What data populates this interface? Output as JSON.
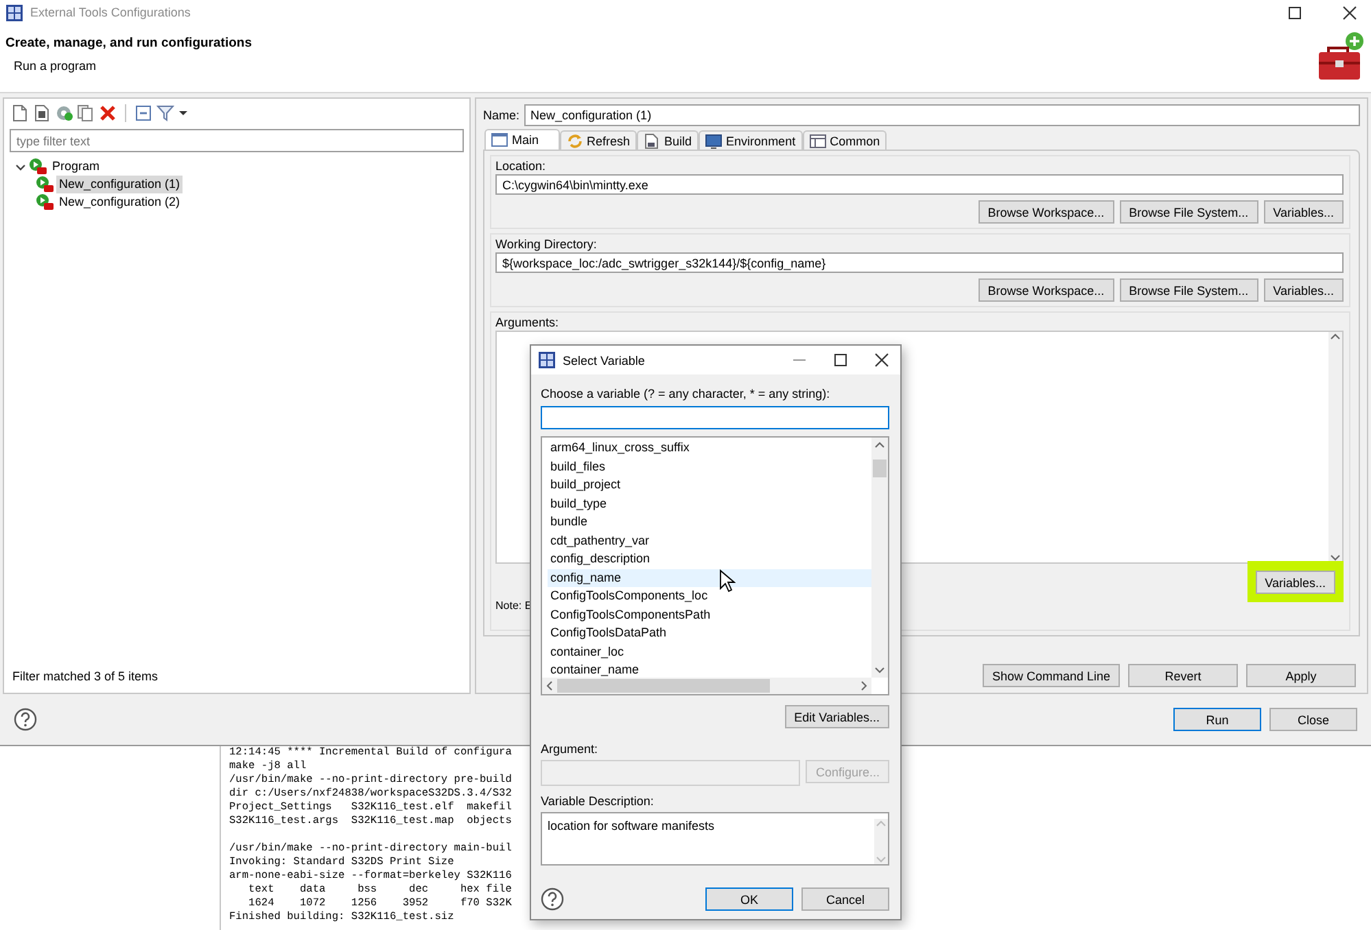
{
  "window": {
    "title": "External Tools Configurations"
  },
  "header": {
    "title": "Create, manage, and run configurations",
    "subtitle": "Run a program"
  },
  "filter": {
    "placeholder": "type filter text"
  },
  "tree": [
    {
      "label": "Program",
      "expanded": true,
      "selected": false,
      "children": [
        {
          "label": "New_configuration (1)",
          "selected": true
        },
        {
          "label": "New_configuration (2)",
          "selected": false
        }
      ]
    }
  ],
  "filter_status": "Filter matched 3 of 5 items",
  "name": {
    "label": "Name:",
    "value": "New_configuration (1)"
  },
  "tabs": [
    {
      "label": "Main",
      "kind": "window",
      "selected": true
    },
    {
      "label": "Refresh",
      "kind": "refresh",
      "selected": false
    },
    {
      "label": "Build",
      "kind": "document",
      "selected": false
    },
    {
      "label": "Environment",
      "kind": "monitor",
      "selected": false
    },
    {
      "label": "Common",
      "kind": "table",
      "selected": false
    }
  ],
  "location": {
    "label": "Location:",
    "value": "C:\\cygwin64\\bin\\mintty.exe",
    "buttons": [
      "Browse Workspace...",
      "Browse File System...",
      "Variables..."
    ]
  },
  "working_directory": {
    "label": "Working Directory:",
    "value": "${workspace_loc:/adc_swtrigger_s32k144}/${config_name}",
    "buttons": [
      "Browse Workspace...",
      "Browse File System...",
      "Variables..."
    ]
  },
  "arguments": {
    "label": "Arguments:",
    "variables_button": {
      "label": "Variables...",
      "highlighted": true
    },
    "note": "Note: E"
  },
  "actions": [
    "Show Command Line",
    "Revert",
    "Apply"
  ],
  "dialog_buttons": [
    "Run",
    "Close"
  ],
  "console": {
    "lines": [
      {
        "kind": "text",
        "text": "12:14:45 **** Incremental Build of configura"
      },
      {
        "kind": "text",
        "text": "make -j8 all"
      },
      {
        "kind": "text",
        "text": "/usr/bin/make --no-print-directory pre-build"
      },
      {
        "kind": "text",
        "text": "dir c:/Users/nxf24838/workspaceS32DS.3.4/S32"
      },
      {
        "kind": "text",
        "text": "Project_Settings   S32K116_test.elf  makefil"
      },
      {
        "kind": "text",
        "text": "S32K116_test.args  S32K116_test.map  objects"
      },
      {
        "kind": "blank"
      },
      {
        "kind": "text",
        "text": "/usr/bin/make --no-print-directory main-buil"
      },
      {
        "kind": "text",
        "text": "Invoking: Standard S32DS Print Size"
      },
      {
        "kind": "text",
        "text": "arm-none-eabi-size --format=berkeley S32K116"
      },
      {
        "kind": "text",
        "text": "   text    data     bss     dec     hex file"
      },
      {
        "kind": "text",
        "text": "   1624    1072    1256    3952     f70 S32K"
      },
      {
        "kind": "text",
        "text": "Finished building: S32K116_test.siz"
      }
    ]
  },
  "select_variable": {
    "title": "Select Variable",
    "prompt": "Choose a variable (? = any character, * = any string):",
    "items": [
      {
        "label": "arm64_linux_cross_suffix",
        "selected": false
      },
      {
        "label": "build_files",
        "selected": false
      },
      {
        "label": "build_project",
        "selected": false
      },
      {
        "label": "build_type",
        "selected": false
      },
      {
        "label": "bundle",
        "selected": false
      },
      {
        "label": "cdt_pathentry_var",
        "selected": false
      },
      {
        "label": "config_description",
        "selected": false
      },
      {
        "label": "config_name",
        "selected": true
      },
      {
        "label": "ConfigToolsComponents_loc",
        "selected": false
      },
      {
        "label": "ConfigToolsComponentsPath",
        "selected": false
      },
      {
        "label": "ConfigToolsDataPath",
        "selected": false
      },
      {
        "label": "container_loc",
        "selected": false
      },
      {
        "label": "container_name",
        "selected": false
      }
    ],
    "edit_button": "Edit Variables...",
    "argument": {
      "label": "Argument:",
      "disabled": true,
      "button": "Configure..."
    },
    "description": {
      "label": "Variable Description:",
      "value": "location for software manifests"
    },
    "buttons": [
      "OK",
      "Cancel"
    ]
  }
}
